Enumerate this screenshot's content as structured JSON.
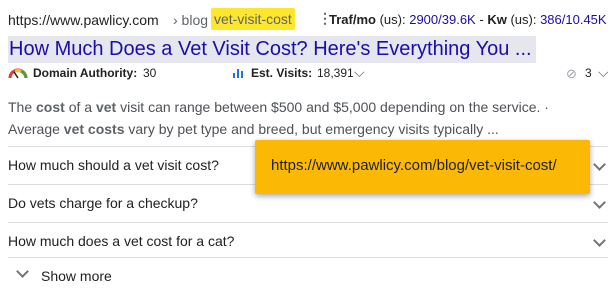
{
  "result": {
    "url_base": "https://www.pawlicy.com",
    "url_crumb": "› blog ›",
    "url_slug": "vet-visit-cost",
    "menu_glyph": "⋮",
    "traffic": {
      "traf_label": "Traf/mo",
      "traf_us": "(us):",
      "traf_value": "2900/39.6K",
      "sep": "-",
      "kw_label": "Kw",
      "kw_us": "(us):",
      "kw_value": "386/10.45K"
    },
    "title": "How Much Does a Vet Visit Cost? Here's Everything You ...",
    "metrics": {
      "da_label": "Domain Authority:",
      "da_value": "30",
      "ev_label": "Est. Visits:",
      "ev_value": "18,391",
      "link_count": "3"
    },
    "snippet": {
      "p1": "The ",
      "b1": "cost",
      "p2": " of a ",
      "b2": "vet",
      "p3": " visit can range between $500 and $5,000 depending on the service. · Average ",
      "b3": "vet costs",
      "p4": " vary by pet type and breed, but emergency visits typically ..."
    }
  },
  "faqs": [
    {
      "question": "How much should a vet visit cost?"
    },
    {
      "question": "Do vets charge for a checkup?"
    },
    {
      "question": "How much does a vet cost for a cat?"
    }
  ],
  "show_more_label": "Show more",
  "tooltip": {
    "text": "https://www.pawlicy.com/blog/vet-visit-cost/"
  },
  "colors": {
    "link": "#1a0dab",
    "highlight": "#fde72e",
    "tooltip_bg": "#fbb905",
    "title_bg": "#e6e7ee"
  }
}
